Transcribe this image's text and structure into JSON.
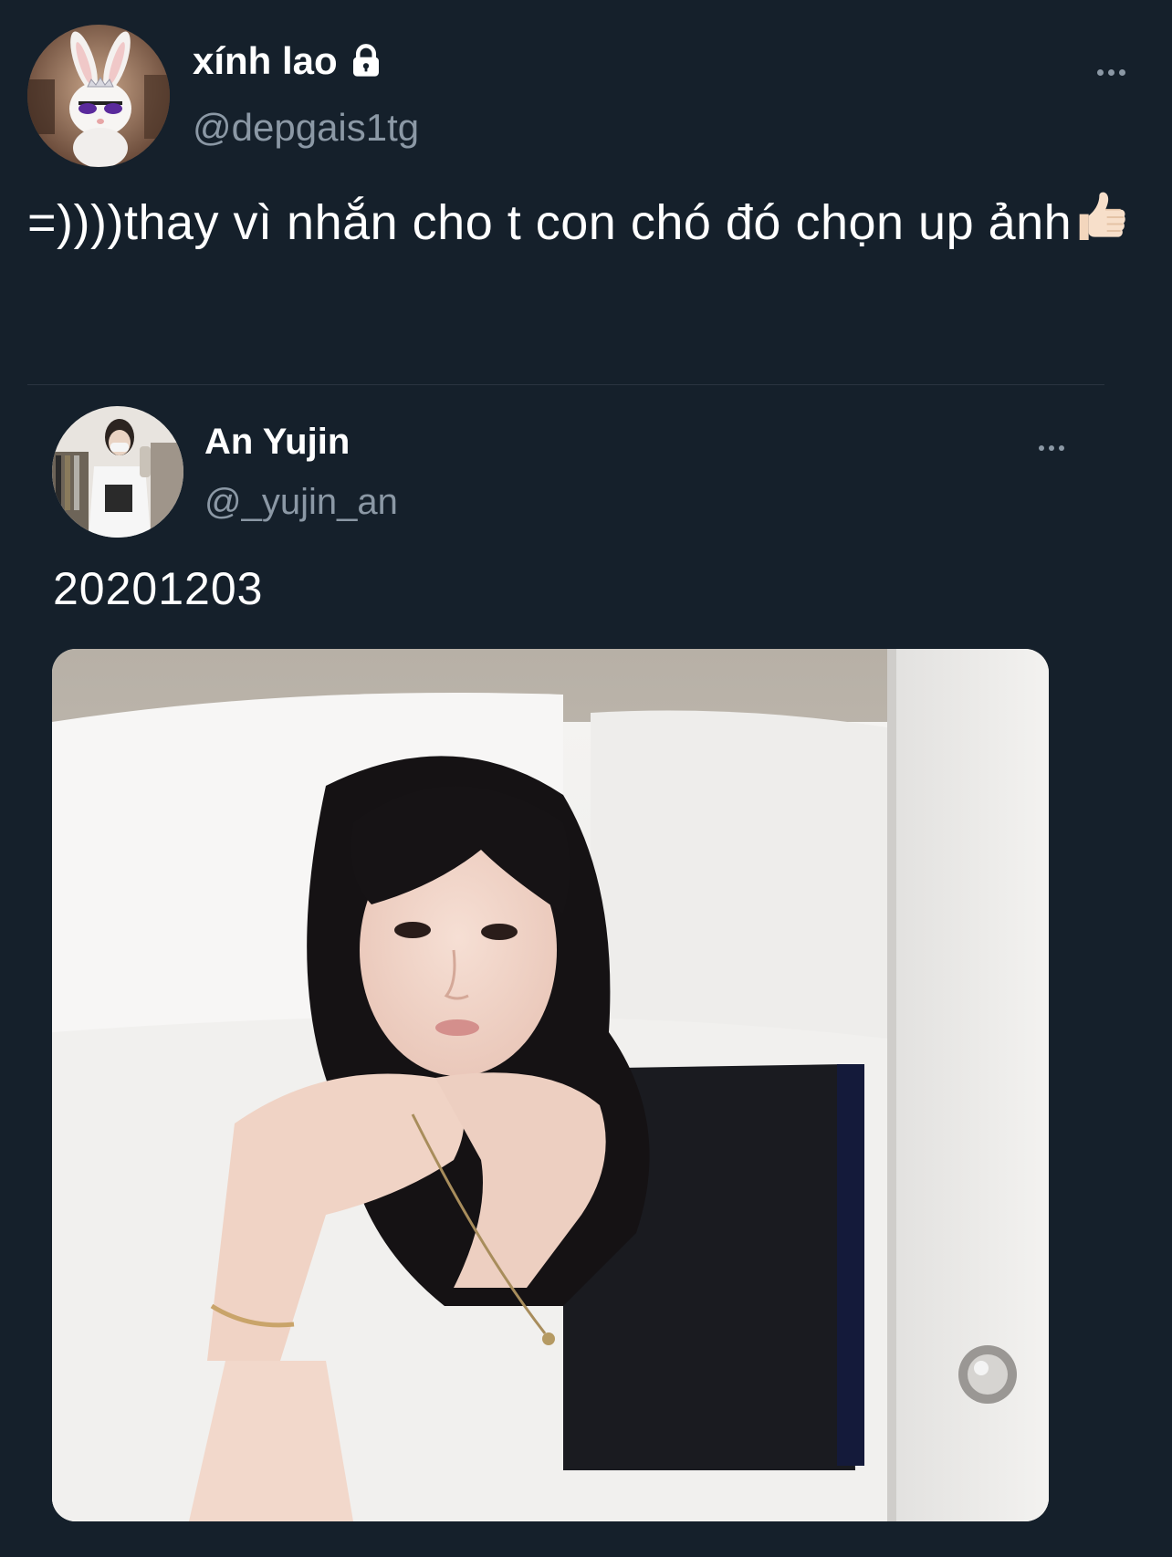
{
  "tweet": {
    "author": {
      "display_name": "xính lao",
      "handle": "@depgais1tg",
      "protected_icon": "lock-icon",
      "avatar_icon": "bunny-avatar"
    },
    "text": "=))))thay vì nhắn cho t con chó đó chọn up ảnh",
    "emoji": "thumbs-up-emoji"
  },
  "quoted_tweet": {
    "author": {
      "display_name": "An Yujin",
      "handle": "@_yujin_an",
      "avatar_icon": "person-avatar"
    },
    "text": "20201203",
    "media_icon": "photo"
  },
  "colors": {
    "background": "#15202b",
    "secondary_text": "#8b98a5",
    "divider": "#2a3440"
  }
}
